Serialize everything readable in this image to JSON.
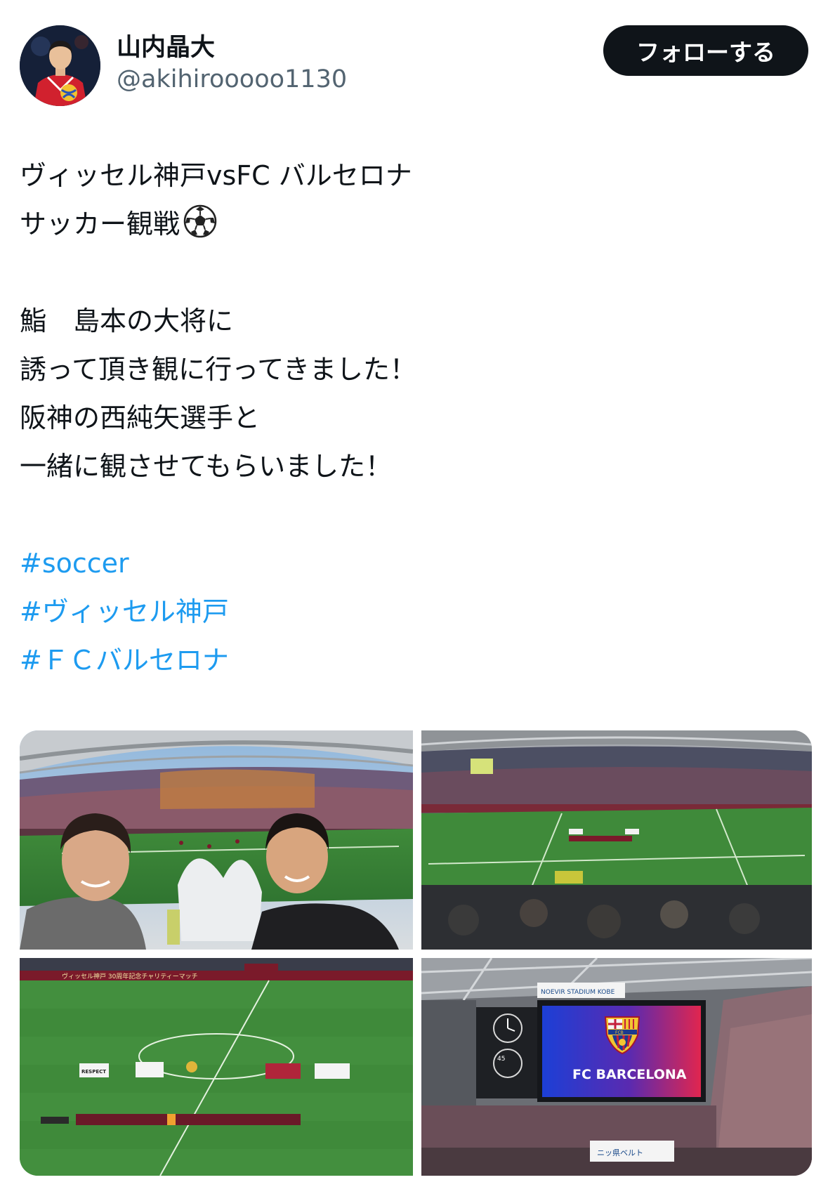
{
  "author": {
    "display_name": "山内晶大",
    "handle": "@akihirooooo1130",
    "avatar_icon": "profile-photo"
  },
  "follow_button": {
    "label": "フォローする"
  },
  "tweet": {
    "lines": [
      "ヴィッセル神戸vsFC バルセロナ",
      "サッカー観戦",
      "",
      "鮨　島本の大将に",
      "誘って頂き観に行ってきました！",
      "阪神の西純矢選手と",
      "一緒に観させてもらいました！",
      ""
    ],
    "emoji": "soccer-ball-icon",
    "hashtags": [
      "#soccer",
      "#ヴィッセル神戸",
      "#ＦＣバルセロナ"
    ]
  },
  "media": {
    "photos": [
      {
        "name": "selfie-in-stadium-photo"
      },
      {
        "name": "stadium-pitch-lineup-photo"
      },
      {
        "name": "pitch-ceremony-photo"
      },
      {
        "name": "scoreboard-photo"
      }
    ],
    "banner_text": "ヴィッセル神戸 30周年記念チャリティーマッチ",
    "scoreboard_text": "FC BARCELONA",
    "stadium_sign": "NOEVIR STADIUM KOBE",
    "crest_text": "FCB",
    "respect_text": "RESPECT",
    "clock_number": "45",
    "sponsor_text": "ニッ県ベルト"
  },
  "colors": {
    "follow_bg": "#0f1419",
    "hashtag": "#1d9bf0",
    "handle": "#536471",
    "pitch": "#3f8a3a",
    "barca_blue": "#1c3fd6",
    "barca_red": "#e0264f"
  }
}
